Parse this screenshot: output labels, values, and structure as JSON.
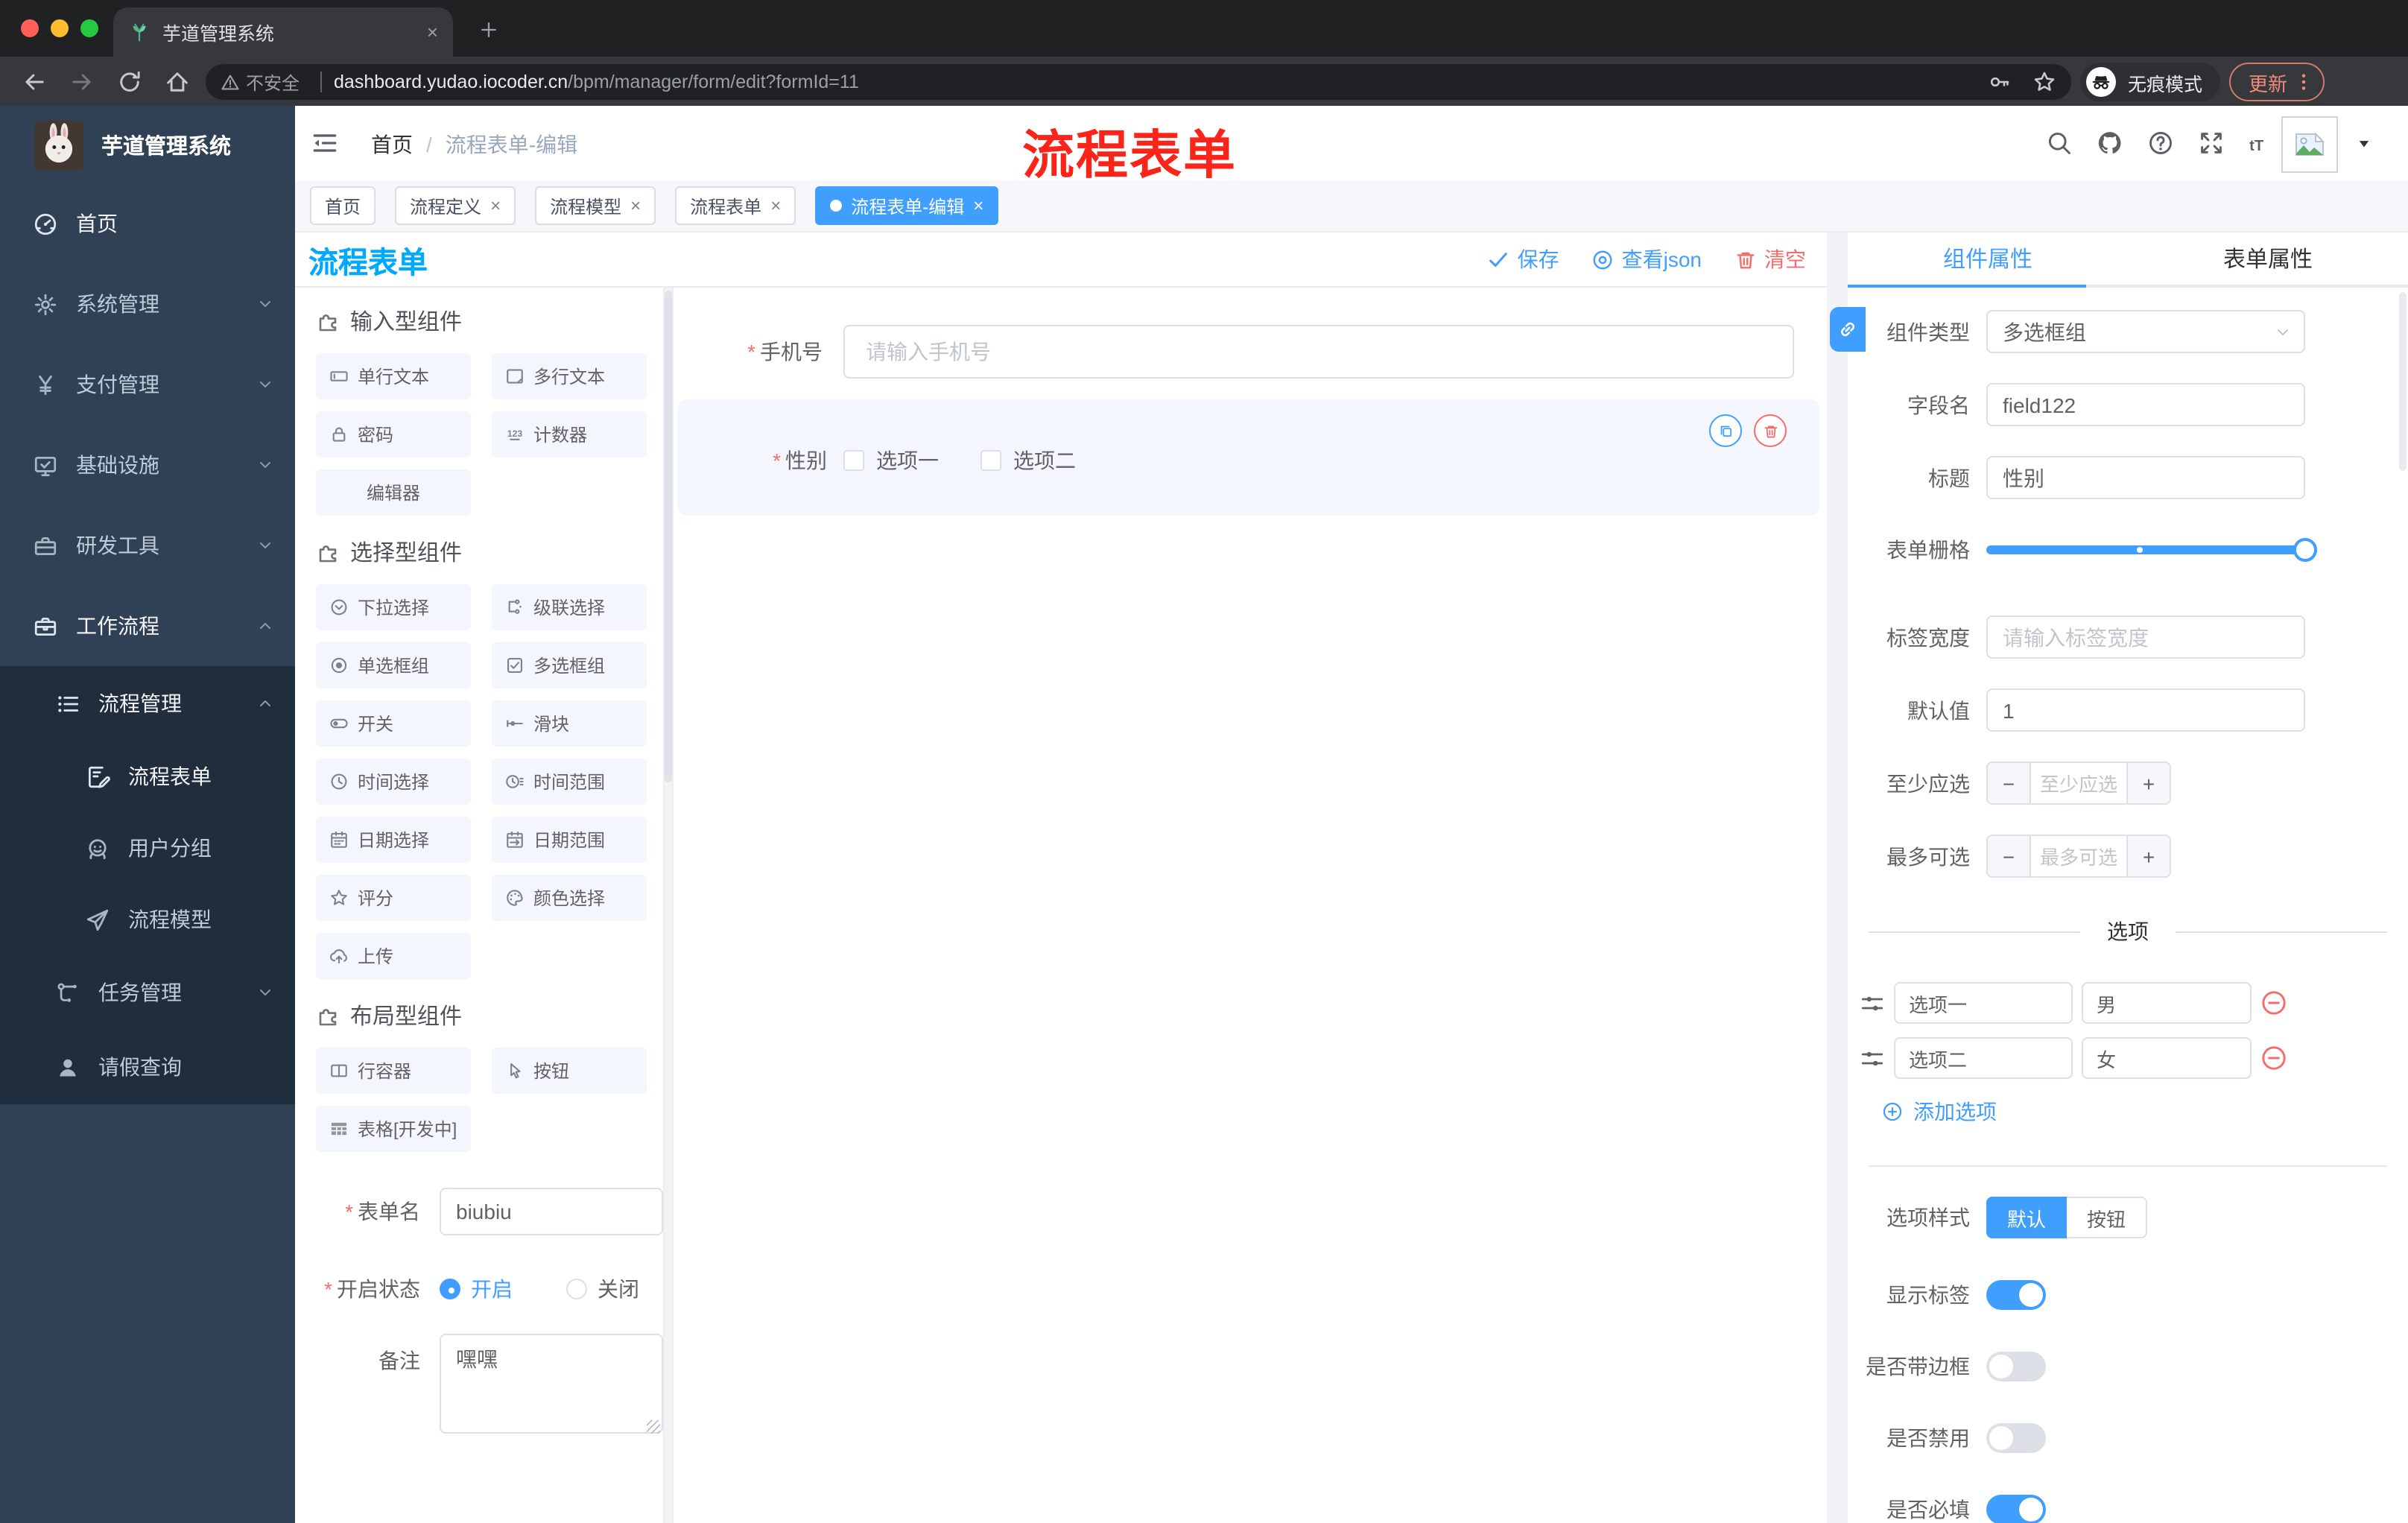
{
  "glyphs": {
    "required": "*",
    "close": "×",
    "minus": "−",
    "plus": "+",
    "slash": "/"
  },
  "browser": {
    "traffic_colors": [
      "#ff5f57",
      "#febc2e",
      "#28c840"
    ],
    "tab_title": "芋道管理系统",
    "url": {
      "security": "不安全",
      "host": "dashboard.yudao.iocoder.cn",
      "path": "/bpm/manager/form/edit?formId=11"
    },
    "incognito_label": "无痕模式",
    "update_label": "更新"
  },
  "sidebar": {
    "logo_title": "芋道管理系统",
    "items": [
      {
        "label": "首页",
        "icon": "dashboard-icon",
        "level": 1,
        "active": true
      },
      {
        "label": "系统管理",
        "icon": "gear-icon",
        "level": 1,
        "chevron": "down"
      },
      {
        "label": "支付管理",
        "icon": "yen-icon",
        "level": 1,
        "chevron": "down"
      },
      {
        "label": "基础设施",
        "icon": "monitor-icon",
        "level": 1,
        "chevron": "down"
      },
      {
        "label": "研发工具",
        "icon": "toolbox-icon",
        "level": 1,
        "chevron": "down"
      },
      {
        "label": "工作流程",
        "icon": "briefcase-icon",
        "level": 1,
        "chevron": "up",
        "active": true
      },
      {
        "label": "流程管理",
        "icon": "tree-list-icon",
        "level": 2,
        "chevron": "up",
        "dark": true,
        "active": true
      },
      {
        "label": "流程表单",
        "icon": "doc-edit-icon",
        "level": 3,
        "dark": true,
        "active": true
      },
      {
        "label": "用户分组",
        "icon": "users-icon",
        "level": 3,
        "dark": true
      },
      {
        "label": "流程模型",
        "icon": "paper-plane-icon",
        "level": 3,
        "dark": true
      },
      {
        "label": "任务管理",
        "icon": "flow-icon",
        "level": 2,
        "chevron": "down",
        "dark": true
      },
      {
        "label": "请假查询",
        "icon": "person-icon",
        "level": 2,
        "dark": true
      }
    ]
  },
  "navbar": {
    "breadcrumb": {
      "first": "首页",
      "second": "流程表单-编辑"
    },
    "annotation": "流程表单",
    "annotation_color": "#fa2419"
  },
  "tagsbar": {
    "tags": [
      {
        "label": "首页"
      },
      {
        "label": "流程定义",
        "closable": true
      },
      {
        "label": "流程模型",
        "closable": true
      },
      {
        "label": "流程表单",
        "closable": true
      },
      {
        "label": "流程表单-编辑",
        "closable": true,
        "active": true
      }
    ]
  },
  "designer": {
    "title": "流程表单",
    "actions": [
      {
        "label": "保存",
        "icon": "check-icon",
        "color": "#409eff"
      },
      {
        "label": "查看json",
        "icon": "view-icon",
        "color": "#409eff"
      },
      {
        "label": "清空",
        "icon": "trash-icon",
        "color": "#f56c6c"
      }
    ],
    "sections": [
      {
        "title": "输入型组件",
        "items": [
          {
            "icon": "text-field-icon",
            "label": "单行文本"
          },
          {
            "icon": "textarea-icon",
            "label": "多行文本"
          },
          {
            "icon": "lock-icon",
            "label": "密码"
          },
          {
            "icon": "counter-icon",
            "label": "计数器"
          },
          {
            "icon": "",
            "label": "编辑器"
          }
        ]
      },
      {
        "title": "选择型组件",
        "items": [
          {
            "icon": "select-icon",
            "label": "下拉选择"
          },
          {
            "icon": "cascader-icon",
            "label": "级联选择"
          },
          {
            "icon": "radio-icon",
            "label": "单选框组"
          },
          {
            "icon": "checkbox-icon",
            "label": "多选框组"
          },
          {
            "icon": "switch-icon",
            "label": "开关"
          },
          {
            "icon": "slider-icon",
            "label": "滑块"
          },
          {
            "icon": "time-icon",
            "label": "时间选择"
          },
          {
            "icon": "time-range-icon",
            "label": "时间范围"
          },
          {
            "icon": "date-icon",
            "label": "日期选择"
          },
          {
            "icon": "date-range-icon",
            "label": "日期范围"
          },
          {
            "icon": "star-icon",
            "label": "评分"
          },
          {
            "icon": "palette-icon",
            "label": "颜色选择"
          },
          {
            "icon": "upload-icon",
            "label": "上传"
          }
        ]
      },
      {
        "title": "布局型组件",
        "items": [
          {
            "icon": "row-icon",
            "label": "行容器"
          },
          {
            "icon": "pointer-icon",
            "label": "按钮"
          },
          {
            "icon": "table-icon",
            "label": "表格[开发中]"
          }
        ]
      }
    ],
    "form": {
      "name_label": "表单名",
      "name_value": "biubiu",
      "status_label": "开启状态",
      "status_on": "开启",
      "status_off": "关闭",
      "remark_label": "备注",
      "remark_value": "嘿嘿"
    }
  },
  "canvas": {
    "phone": {
      "label": "手机号",
      "placeholder": "请输入手机号"
    },
    "gender": {
      "label": "性别",
      "options": [
        "选项一",
        "选项二"
      ]
    }
  },
  "panel": {
    "tabs": {
      "component": "组件属性",
      "form": "表单属性"
    },
    "fields": {
      "type_label": "组件类型",
      "type_value": "多选框组",
      "name_label": "字段名",
      "name_value": "field122",
      "title_label": "标题",
      "title_value": "性别",
      "grid_label": "表单栅格",
      "width_label": "标签宽度",
      "width_placeholder": "请输入标签宽度",
      "default_label": "默认值",
      "default_value": "1",
      "min_label": "至少应选",
      "min_placeholder": "至少应选",
      "max_label": "最多可选",
      "max_placeholder": "最多可选"
    },
    "options": {
      "divider": "选项",
      "rows": [
        {
          "label": "选项一",
          "value": "男"
        },
        {
          "label": "选项二",
          "value": "女"
        }
      ],
      "add_label": "添加选项"
    },
    "style": {
      "label": "选项样式",
      "options": [
        "默认",
        "按钮"
      ],
      "selected": "默认"
    },
    "switches": [
      {
        "label": "显示标签",
        "on": true
      },
      {
        "label": "是否带边框",
        "on": false
      },
      {
        "label": "是否禁用",
        "on": false
      },
      {
        "label": "是否必填",
        "on": true
      }
    ]
  }
}
